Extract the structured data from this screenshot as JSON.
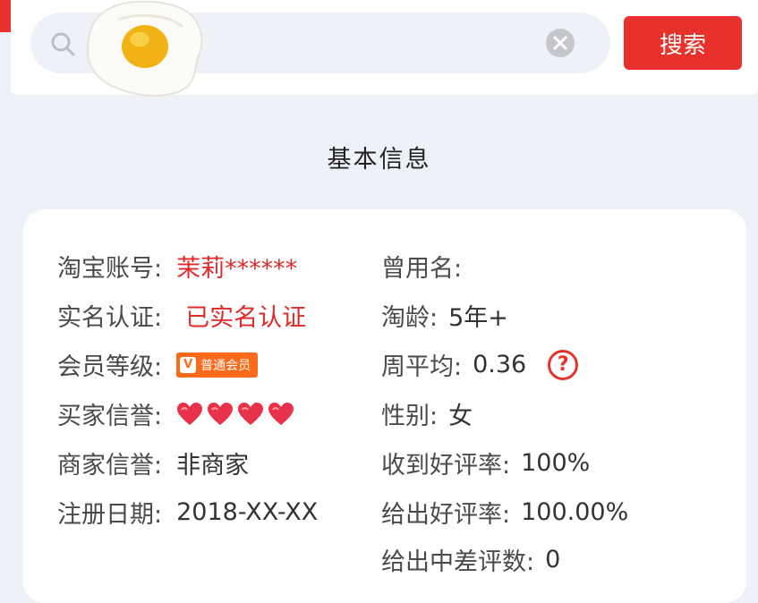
{
  "search": {
    "value": "",
    "button_label": "搜索"
  },
  "section": {
    "title": "基本信息"
  },
  "info": {
    "left": [
      {
        "label": "淘宝账号:",
        "value": "茉莉******"
      },
      {
        "label": "实名认证:",
        "value": "已实名认证"
      },
      {
        "label": "会员等级:",
        "badge_text": "普通会员"
      },
      {
        "label": "买家信誉:",
        "hearts": 4
      },
      {
        "label": "商家信誉:",
        "value": "非商家"
      },
      {
        "label": "注册日期:",
        "value": "2018-XX-XX"
      }
    ],
    "right": [
      {
        "label": "曾用名:",
        "value": ""
      },
      {
        "label": "淘龄:",
        "value": "5年+"
      },
      {
        "label": "周平均:",
        "value": "0.36"
      },
      {
        "label": "性别:",
        "value": "女"
      },
      {
        "label": "收到好评率:",
        "value": "100%"
      },
      {
        "label": "给出好评率:",
        "value": "100.00%"
      },
      {
        "label": "给出中差评数:",
        "value": "0"
      }
    ]
  },
  "colors": {
    "accent": "#e8312a",
    "background": "#eef2f8",
    "heart": "#e8314a",
    "badge": "#ff6a1a"
  },
  "icons": {
    "search": "search-icon",
    "clear": "clear-icon",
    "help": "help-icon",
    "heart": "heart-icon",
    "sticker": "fried-egg-sticker"
  }
}
